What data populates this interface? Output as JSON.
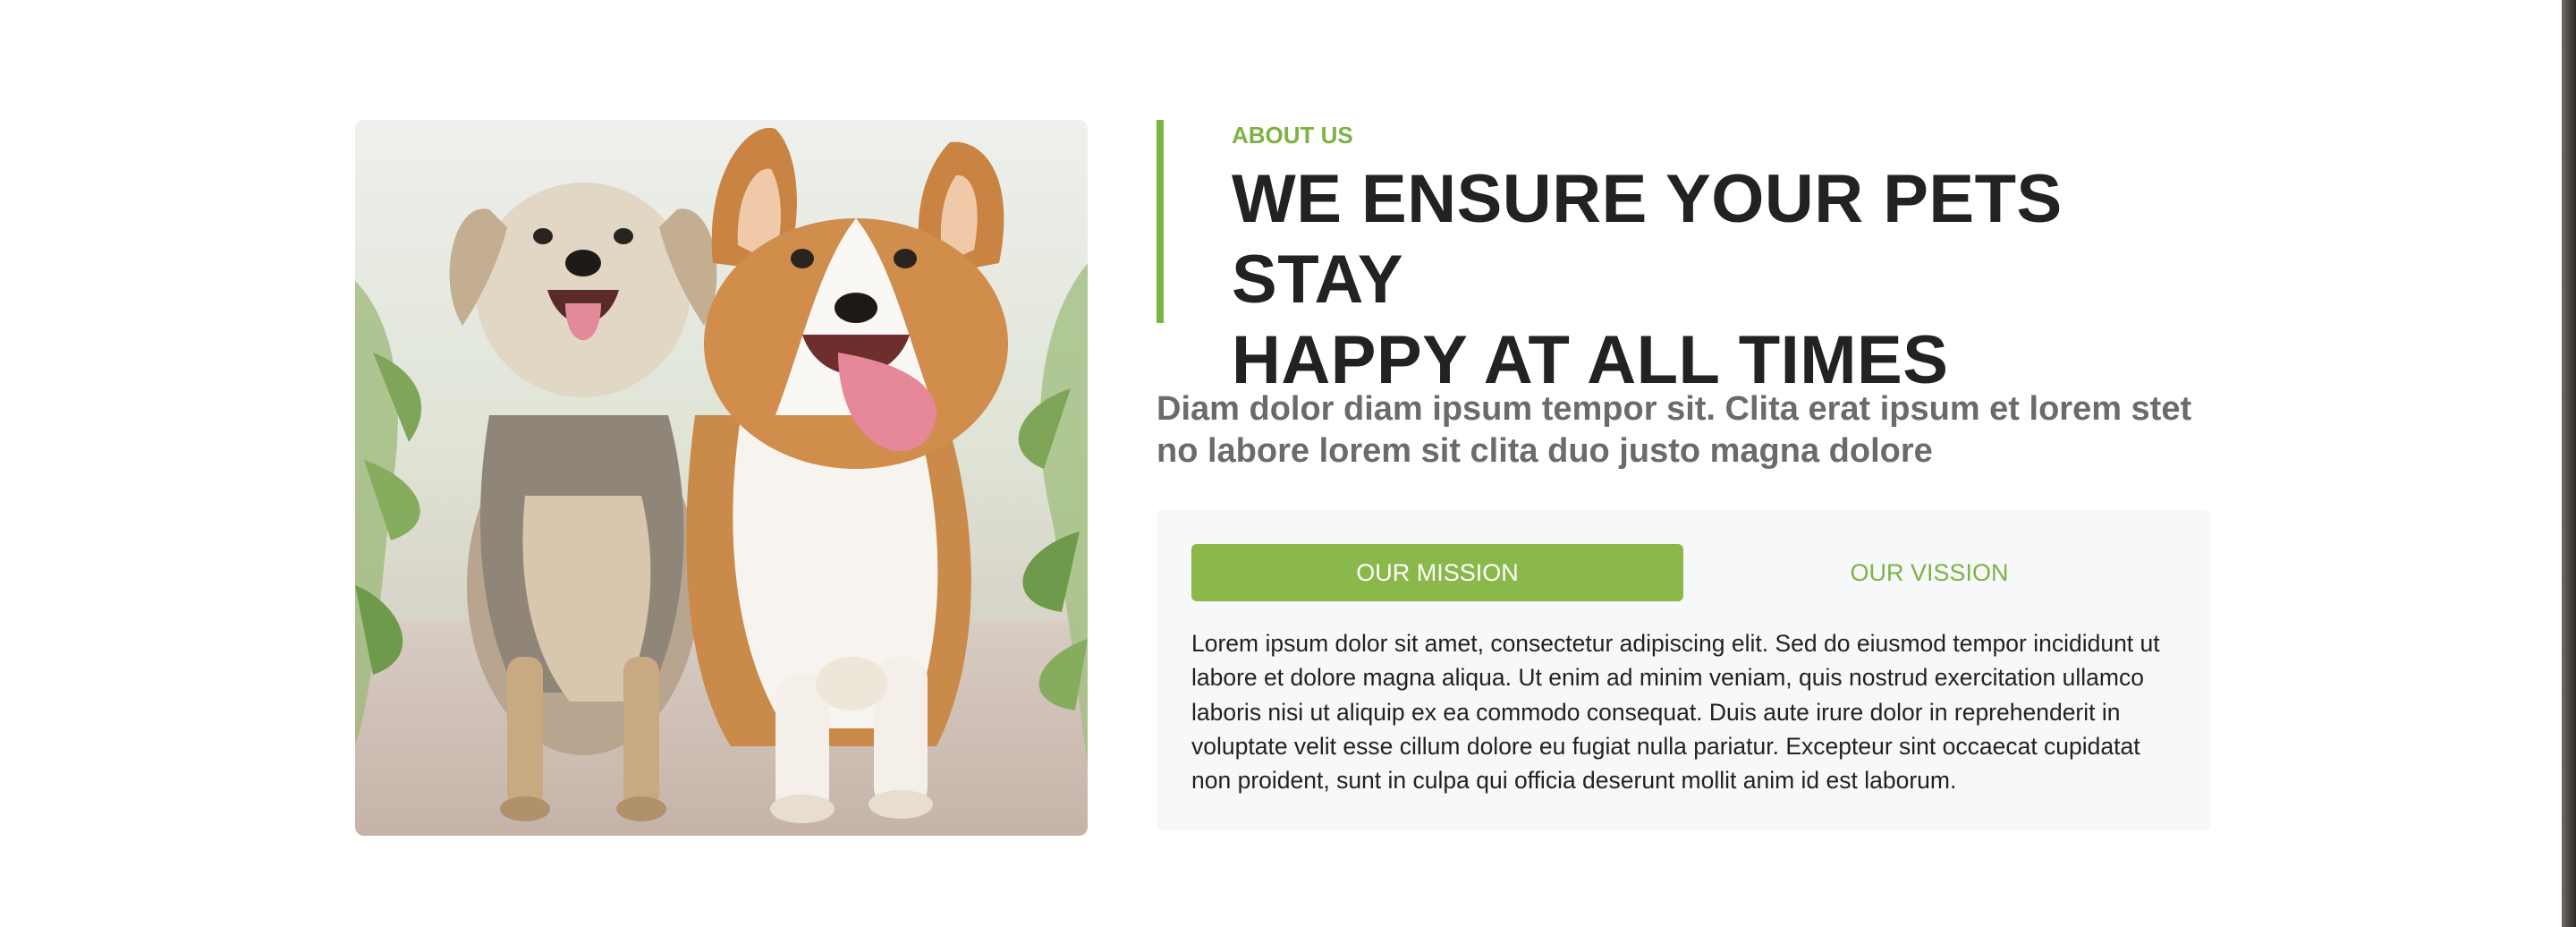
{
  "about": {
    "eyebrow": "ABOUT US",
    "title_line1": "WE ENSURE YOUR PETS STAY",
    "title_line2": "HAPPY AT ALL TIMES",
    "lead": "Diam dolor diam ipsum tempor sit. Clita erat ipsum et lorem stet no labore lorem sit clita duo justo magna dolore"
  },
  "tabs": [
    {
      "label": "OUR MISSION",
      "active": true
    },
    {
      "label": "OUR VISSION",
      "active": false
    }
  ],
  "tab_content": "Lorem ipsum dolor sit amet, consectetur adipiscing elit. Sed do eiusmod tempor incididunt ut labore et dolore magna aliqua. Ut enim ad minim veniam, quis nostrud exercitation ullamco laboris nisi ut aliquip ex ea commodo consequat. Duis aute irure dolor in reprehenderit in voluptate velit esse cillum dolore eu fugiat nulla pariatur. Excepteur sint occaecat cupidatat non proident, sunt in culpa qui officia deserunt mollit anim id est laborum.",
  "colors": {
    "accent": "#7cb342",
    "tab_active_bg": "#8bb84a",
    "title": "#222222",
    "lead": "#6b6b6b",
    "panel_bg": "#f7f8f9"
  },
  "image": {
    "icon": "dogs-photo"
  }
}
